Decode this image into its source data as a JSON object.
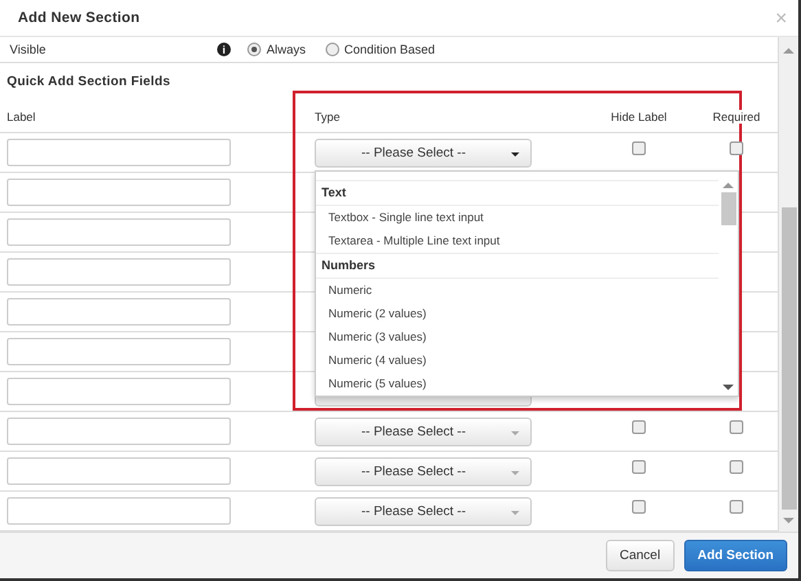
{
  "dialog": {
    "title": "Add New Section",
    "close": "×"
  },
  "visible_row": {
    "label": "Visible",
    "info": "i",
    "options": [
      {
        "label": "Always",
        "selected": true
      },
      {
        "label": "Condition Based",
        "selected": false
      }
    ]
  },
  "section_title": "Quick Add Section Fields",
  "columns": {
    "label": "Label",
    "type": "Type",
    "hide_label": "Hide Label",
    "required": "Required"
  },
  "rows": [
    {
      "type": "-- Please Select --",
      "hide_label": false,
      "required": false
    },
    {},
    {},
    {},
    {},
    {},
    {},
    {
      "type": "-- Please Select --",
      "hide_label": false,
      "required": false
    },
    {
      "type": "-- Please Select --",
      "hide_label": false,
      "required": false
    },
    {
      "type": "-- Please Select --",
      "hide_label": false,
      "required": false
    }
  ],
  "dropdown": {
    "groups": [
      {
        "name": "Text",
        "options": [
          "Textbox - Single line text input",
          "Textarea - Multiple Line text input"
        ]
      },
      {
        "name": "Numbers",
        "options": [
          "Numeric",
          "Numeric (2 values)",
          "Numeric (3 values)",
          "Numeric (4 values)",
          "Numeric (5 values)"
        ]
      }
    ]
  },
  "buttons": [
    {
      "label": "Cancel",
      "kind": "secondary"
    },
    {
      "label": "Add Section",
      "kind": "primary"
    }
  ]
}
